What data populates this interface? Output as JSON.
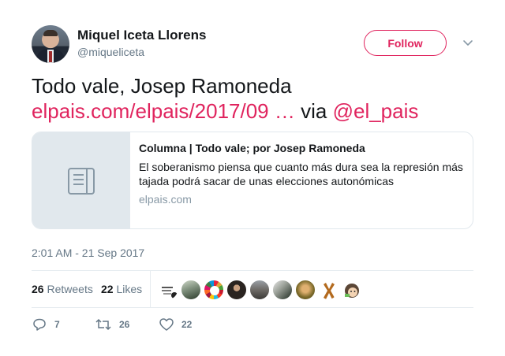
{
  "author": {
    "name": "Miquel Iceta Llorens",
    "handle": "@miqueliceta"
  },
  "follow_label": "Follow",
  "tweet": {
    "text_line1": "Todo vale, Josep Ramoneda",
    "link_url": "elpais.com/elpais/2017/09",
    "ellipsis": "…",
    "via_label": "via",
    "mention": "@el_pais"
  },
  "card": {
    "title": "Columna | Todo vale; por Josep Ramoneda",
    "description": "El soberanismo piensa que cuanto más dura sea la represión más tajada podrá sacar de unas elecciones autonómicas",
    "domain": "elpais.com"
  },
  "timestamp": "2:01 AM - 21 Sep 2017",
  "stats": {
    "retweets_count": "26",
    "retweets_label": "Retweets",
    "likes_count": "22",
    "likes_label": "Likes"
  },
  "actions": {
    "reply_count": "7",
    "retweet_count": "26",
    "like_count": "22"
  },
  "colors": {
    "accent": "#e0245e",
    "muted": "#657786",
    "border": "#e6ecf0"
  }
}
